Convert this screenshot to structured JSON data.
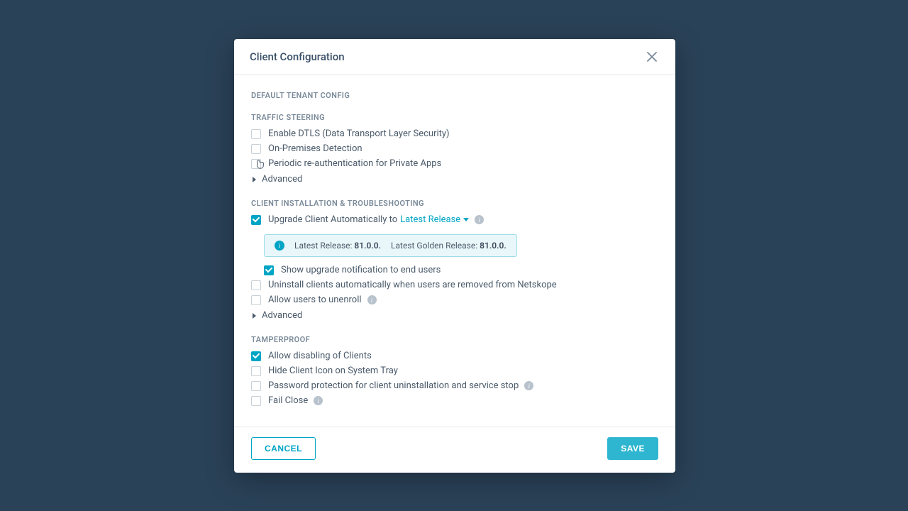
{
  "modal": {
    "title": "Client Configuration",
    "heading": "DEFAULT TENANT CONFIG",
    "sections": {
      "traffic": {
        "heading": "TRAFFIC STEERING",
        "enable_dtls": "Enable DTLS (Data Transport Layer Security)",
        "on_premises": "On-Premises Detection",
        "periodic_reauth": "Periodic re-authentication for Private Apps",
        "advanced": "Advanced"
      },
      "install": {
        "heading": "CLIENT INSTALLATION & TROUBLESHOOTING",
        "upgrade_auto": "Upgrade Client Automatically to",
        "upgrade_dropdown": "Latest Release",
        "release_info": {
          "latest_label": "Latest Release:",
          "latest_value": "81.0.0.",
          "golden_label": "Latest Golden Release:",
          "golden_value": "81.0.0."
        },
        "show_notification": "Show upgrade notification to end users",
        "uninstall_auto": "Uninstall clients automatically when users are removed from Netskope",
        "allow_unenroll": "Allow users to unenroll",
        "advanced": "Advanced"
      },
      "tamper": {
        "heading": "TAMPERPROOF",
        "allow_disable": "Allow disabling of Clients",
        "hide_icon": "Hide Client Icon on System Tray",
        "password_protect": "Password protection for client uninstallation and service stop",
        "fail_close": "Fail Close"
      }
    },
    "buttons": {
      "cancel": "Cancel",
      "save": "Save"
    }
  }
}
